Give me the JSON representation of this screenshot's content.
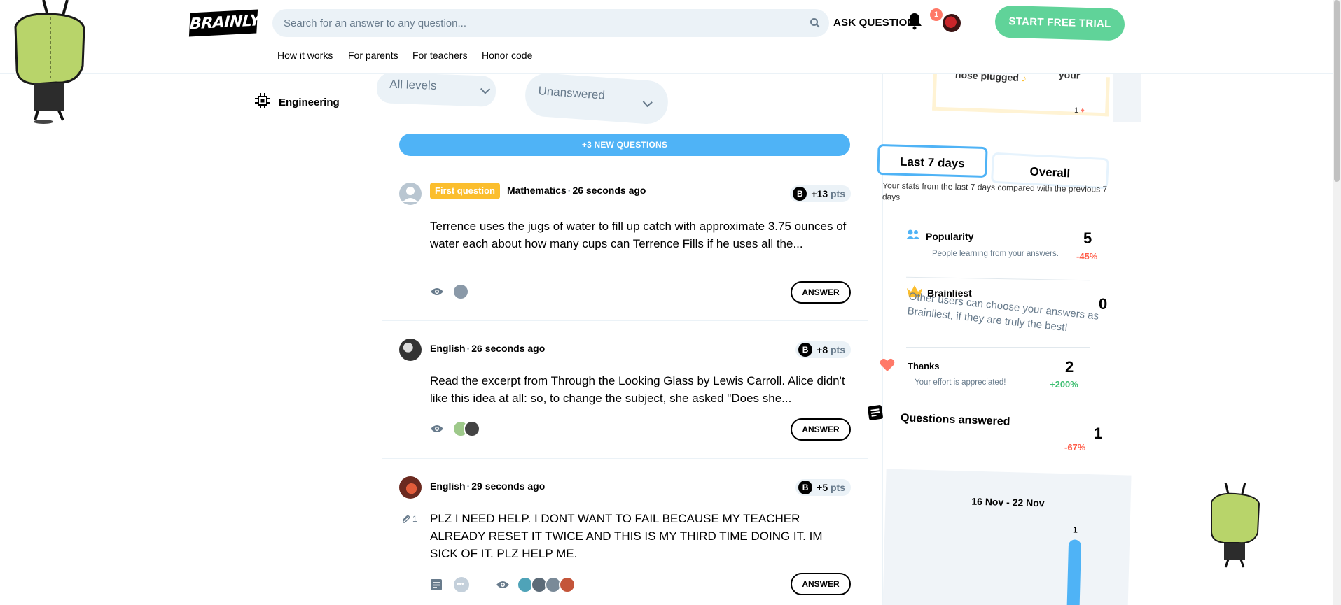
{
  "header": {
    "logo": "BRAINLY",
    "search_placeholder": "Search for an answer to any question...",
    "ask_question": "ASK QUESTION",
    "notification_count": "1",
    "start_trial": "START FREE TRIAL",
    "nav": [
      "How it works",
      "For parents",
      "For teachers",
      "Honor code"
    ]
  },
  "sidebar": {
    "subject": "Engineering"
  },
  "filters": {
    "level": "All levels",
    "status": "Unanswered"
  },
  "new_questions_label": "+3 NEW QUESTIONS",
  "questions": [
    {
      "badge": "First question",
      "subject": "Mathematics",
      "time": "26 seconds ago",
      "points": "+13",
      "points_unit": "pts",
      "text": "Terrence uses the jugs of water to fill up catch with approximate 3.75 ounces of water each about how many cups can Terrence Fills if he uses all the...",
      "answer_label": "ANSWER"
    },
    {
      "subject": "English",
      "time": "26 seconds ago",
      "points": "+8",
      "points_unit": "pts",
      "text": "Read the excerpt from Through the Looking Glass by Lewis Carroll. Alice didn't like this idea at all: so, to change the subject, she asked \"Does she...",
      "answer_label": "ANSWER"
    },
    {
      "subject": "English",
      "time": "29 seconds ago",
      "points": "+5",
      "points_unit": "pts",
      "attachments": "1",
      "text": "PLZ I NEED HELP. I DONT WANT TO FAIL BECAUSE MY TEACHER ALREADY RESET IT TWICE AND THIS IS MY THIRD TIME DOING IT. IM SICK OF IT. PLZ HELP ME.",
      "answer_label": "ANSWER"
    }
  ],
  "stats": {
    "top_card_text": "nose plugged",
    "top_card_text_right": "your",
    "top_card_count": "1",
    "tabs": [
      "Last 7 days",
      "Overall"
    ],
    "intro": "Your stats from the last 7 days compared with the previous 7 days",
    "popularity": {
      "label": "Popularity",
      "desc": "People learning from your answers.",
      "value": "5",
      "delta": "-45%"
    },
    "brainliest": {
      "label": "Brainliest",
      "desc": "Other users can choose your answers as Brainliest, if they are truly the best!",
      "value": "0"
    },
    "thanks": {
      "label": "Thanks",
      "desc": "Your effort is appreciated!",
      "value": "2",
      "delta": "+200%"
    },
    "answered": {
      "label": "Questions answered",
      "value": "1",
      "delta": "-67%"
    }
  },
  "chart_data": {
    "type": "bar",
    "title": "16 Nov - 22 Nov",
    "values": [
      1
    ],
    "data_labels": [
      "1"
    ]
  },
  "colors": {
    "accent_blue": "#4fb3f6",
    "trial_green": "#60d399",
    "first_badge": "#fbbe2e",
    "negative": "#ff5c48",
    "positive": "#3fbf72"
  }
}
